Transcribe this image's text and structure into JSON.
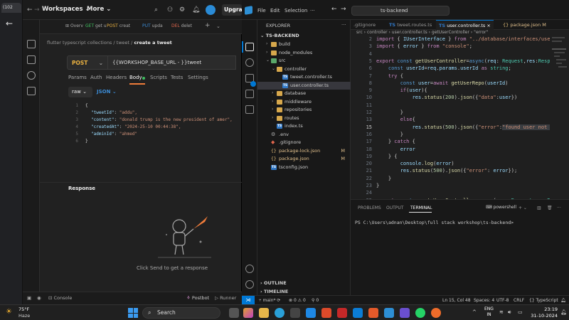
{
  "browser": {
    "tab_label": "(102",
    "back": "←"
  },
  "postman": {
    "menu": {
      "workspaces": "Workspaces",
      "more": "More",
      "upgrade": "Upgrade"
    },
    "tabs": [
      {
        "label": "Overv",
        "method": ""
      },
      {
        "label": "get u",
        "method": "GET"
      },
      {
        "label": "creat",
        "method": "POST"
      },
      {
        "label": "upda",
        "method": "PUT"
      },
      {
        "label": "delet",
        "method": "DEL"
      }
    ],
    "breadcrumb": {
      "collection": "flutter typescript collections",
      "folder": "tweet",
      "current": "create a tweet"
    },
    "request": {
      "method": "POST",
      "url": "{{WORKSHOP_BASE_URL - }}tweet"
    },
    "subtabs": [
      "Params",
      "Auth",
      "Headers",
      "Body",
      "Scripts",
      "Tests",
      "Settings"
    ],
    "body_mode": "raw",
    "body_format": "JSON",
    "body_lines": [
      {
        "n": "1",
        "text": "{"
      },
      {
        "n": "2",
        "key": "\"tweetId\"",
        "val": "\"addu\","
      },
      {
        "n": "3",
        "key": "\"content\"",
        "val": "\"donald trump is the new president of amer\","
      },
      {
        "n": "4",
        "key": "\"createdAt\"",
        "val": "\"2024-25-10 00:44:38\","
      },
      {
        "n": "5",
        "key": "\"adminId\"",
        "val": "\"ahmed\""
      },
      {
        "n": "6",
        "text": "}"
      }
    ],
    "response_label": "Response",
    "send_hint": "Click Send to get a response",
    "status": {
      "console": "Console",
      "postbot": "Postbot",
      "runner": "Runner"
    }
  },
  "vscode": {
    "menu": {
      "file": "File",
      "edit": "Edit",
      "selection": "Selection"
    },
    "search": "ts-backend",
    "explorer_title": "EXPLORER",
    "root": "TS-BACKEND",
    "tree": [
      {
        "label": "build",
        "depth": 1,
        "kind": "folder",
        "chev": "›"
      },
      {
        "label": "node_modules",
        "depth": 1,
        "kind": "folder",
        "chev": "›"
      },
      {
        "label": "src",
        "depth": 1,
        "kind": "folder-green",
        "chev": "⌄"
      },
      {
        "label": "controller",
        "depth": 2,
        "kind": "folder",
        "chev": "⌄"
      },
      {
        "label": "tweet.controller.ts",
        "depth": 3,
        "kind": "ts"
      },
      {
        "label": "user.controller.ts",
        "depth": 3,
        "kind": "ts",
        "selected": true
      },
      {
        "label": "database",
        "depth": 2,
        "kind": "folder",
        "chev": "›"
      },
      {
        "label": "middleware",
        "depth": 2,
        "kind": "folder",
        "chev": "›"
      },
      {
        "label": "repositories",
        "depth": 2,
        "kind": "folder",
        "chev": "›"
      },
      {
        "label": "routes",
        "depth": 2,
        "kind": "folder",
        "chev": "›"
      },
      {
        "label": "index.ts",
        "depth": 2,
        "kind": "ts"
      },
      {
        "label": ".env",
        "depth": 1,
        "kind": "env"
      },
      {
        "label": ".gitignore",
        "depth": 1,
        "kind": "git"
      },
      {
        "label": "package-lock.json",
        "depth": 1,
        "kind": "json",
        "mod": "M"
      },
      {
        "label": "package.json",
        "depth": 1,
        "kind": "json",
        "mod": "M"
      },
      {
        "label": "tsconfig.json",
        "depth": 1,
        "kind": "ts"
      }
    ],
    "outline": "OUTLINE",
    "timeline": "TIMELINE",
    "editor_tabs": [
      {
        "label": ".gitignore",
        "active": false
      },
      {
        "label": "tweet.routes.ts",
        "active": false
      },
      {
        "label": "user.controller.ts",
        "active": true
      },
      {
        "label": "package.json M",
        "active": false
      }
    ],
    "breadcrumb": "src › controller › user.controller.ts › getUserController › \"error\"",
    "code_lines": [
      {
        "n": "2",
        "html": "<span class='kw'>import</span> { <span class='vr'>IUserInterface</span> } <span class='kw'>from</span> <span class='st'>\"../database/interfaces/user.</span>"
      },
      {
        "n": "3",
        "html": "<span class='kw'>import</span> { <span class='vr'>error</span> } <span class='kw'>from</span> <span class='st'>\"console\"</span>;"
      },
      {
        "n": "4",
        "html": ""
      },
      {
        "n": "5",
        "html": "<span class='kw'>export</span> <span class='kw2'>const</span> <span class='fn'>getUserController</span>=<span class='kw2'>async</span>(<span class='vr'>req</span>: <span class='ty'>Request</span>,<span class='vr'>res</span>:<span class='ty'>Respon</span>"
      },
      {
        "n": "6",
        "html": "    <span class='kw2'>const</span> <span class='vr'>userId</span>=<span class='vr'>req</span>.<span class='vr'>params</span>.<span class='vr'>userId</span> <span class='kw'>as</span> <span class='ty'>string</span>;"
      },
      {
        "n": "7",
        "html": "    <span class='kw'>try</span> {"
      },
      {
        "n": "8",
        "html": "        <span class='kw2'>const</span> <span class='vr'>user</span>=<span class='kw'>await</span> <span class='fn'>getUserRepo</span>(<span class='vr'>userId</span>)"
      },
      {
        "n": "9",
        "html": "        <span class='kw'>if</span>(<span class='vr'>user</span>){"
      },
      {
        "n": "10",
        "html": "            <span class='vr'>res</span>.<span class='fn'>status</span>(<span class='nm'>200</span>).<span class='fn'>json</span>({<span class='st'>\"data\"</span>:<span class='vr'>user</span>})"
      },
      {
        "n": "11",
        "html": ""
      },
      {
        "n": "12",
        "html": "        }"
      },
      {
        "n": "13",
        "html": "        <span class='kw'>else</span>{"
      },
      {
        "n": "15",
        "html": "            <span class='vr'>res</span>.<span class='fn'>status</span>(<span class='nm'>500</span>).<span class='fn'>json</span>({<span class='st'>\"error\"</span>:<span class='st sel-hl'>\"found user not fo</span>"
      },
      {
        "n": "16",
        "html": "        }"
      },
      {
        "n": "17",
        "html": "    } <span class='kw'>catch</span> {"
      },
      {
        "n": "18",
        "html": "        <span class='vr'>error</span>"
      },
      {
        "n": "19",
        "html": "    } {"
      },
      {
        "n": "20",
        "html": "        <span class='vr'>console</span>.<span class='fn'>log</span>(<span class='vr'>error</span>)"
      },
      {
        "n": "21",
        "html": "        <span class='vr'>res</span>.<span class='fn'>status</span>(<span class='nm'>500</span>).<span class='fn'>json</span>({<span class='st'>\"error\"</span>: <span class='vr'>error</span>});"
      },
      {
        "n": "22",
        "html": "    }"
      },
      {
        "n": "23",
        "html": "}"
      },
      {
        "n": "24",
        "html": ""
      },
      {
        "n": "25",
        "html": "<span class='kw'>export</span> <span class='kw2'>const</span> <span class='fn'>createUserController</span>=<span class='kw2'>async</span>(<span class='vr'>req</span>: <span class='ty'>Request</span>,<span class='vr'>res</span>:<span class='ty'>Res</span>"
      }
    ],
    "panel_tabs": [
      "PROBLEMS",
      "OUTPUT",
      "TERMINAL"
    ],
    "panel_shell": "powershell",
    "terminal": "PS C:\\Users\\adnan\\Desktop\\full stack workshop\\ts-backend>",
    "status": {
      "branch": "main*",
      "errors": "0",
      "warnings": "0",
      "ports": "0",
      "position": "Ln 15, Col 48",
      "spaces": "Spaces: 4",
      "encoding": "UTF-8",
      "eol": "CRLF",
      "language": "{} TypeScript"
    }
  },
  "taskbar": {
    "temp": "75°F",
    "weather": "Haze",
    "search": "Search",
    "lang_top": "ENG",
    "lang_bottom": "IN",
    "time": "23:19",
    "date": "31-10-2024"
  }
}
